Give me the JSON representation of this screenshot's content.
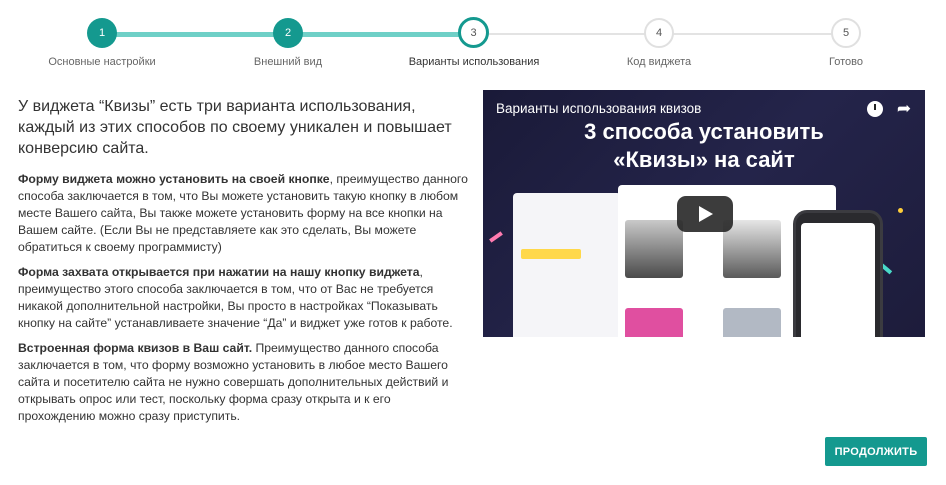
{
  "stepper": {
    "steps": [
      {
        "number": "1",
        "label": "Основные настройки",
        "state": "done"
      },
      {
        "number": "2",
        "label": "Внешний вид",
        "state": "done"
      },
      {
        "number": "3",
        "label": "Варианты использования",
        "state": "current"
      },
      {
        "number": "4",
        "label": "Код виджета",
        "state": "todo"
      },
      {
        "number": "5",
        "label": "Готово",
        "state": "todo"
      }
    ]
  },
  "content": {
    "intro": "У виджета “Квизы” есть три варианта использования, каждый из этих способов по своему уникален и повышает конверсию сайта.",
    "options": [
      {
        "title": "Форму виджета можно установить на своей кнопке",
        "text": ", преимущество данного способа заключается в том, что Вы можете установить такую кнопку в любом месте Вашего сайта, Вы также можете установить форму на все кнопки на Вашем сайте. (Если Вы не представляете как это сделать, Вы можете обратиться к своему программисту)"
      },
      {
        "title": "Форма захвата открывается при нажатии на нашу кнопку виджета",
        "text": ", преимущество этого способа заключается в том, что от Вас не требуется никакой дополнительной настройки, Вы просто в настройках “Показывать кнопку на сайте” устанавливаете значение “Да” и виджет уже готов к работе."
      },
      {
        "title": "Встроенная форма квизов в Ваш сайт.",
        "text": " Преимущество данного способа заключается в том, что форму возможно установить в любое место Вашего сайта и посетителю сайта не нужно совершать дополнительных действий и открывать опрос или тест, поскольку форма сразу открыта и к его прохождению можно сразу приступить."
      }
    ]
  },
  "video": {
    "title": "Варианты использования квизов",
    "headline_line1": "3 способа установить",
    "headline_line2": "«Квизы» на сайт"
  },
  "actions": {
    "continue_label": "ПРОДОЛЖИТЬ"
  },
  "colors": {
    "accent": "#14998f",
    "track_done": "#6fd0c7",
    "track_todo": "#e3e3e3"
  }
}
